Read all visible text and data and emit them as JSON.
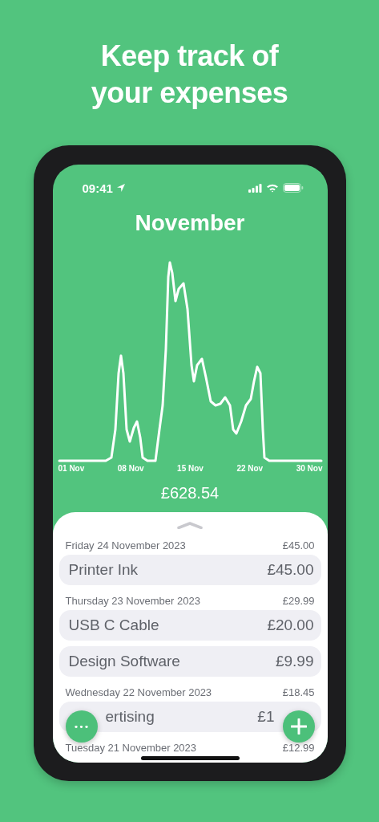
{
  "headline": "Keep track of your expenses",
  "status_bar": {
    "time": "09:41"
  },
  "title": "November",
  "chart_axis_labels": [
    "01 Nov",
    "08 Nov",
    "15 Nov",
    "22 Nov",
    "30 Nov"
  ],
  "total": "£628.54",
  "entries": [
    {
      "kind": "date",
      "date": "Friday 24 November 2023",
      "amount": "£45.00"
    },
    {
      "kind": "item",
      "name": "Printer Ink",
      "amount": "£45.00",
      "covered": false
    },
    {
      "kind": "date",
      "date": "Thursday 23 November 2023",
      "amount": "£29.99"
    },
    {
      "kind": "item",
      "name": "USB C Cable",
      "amount": "£20.00",
      "covered": false
    },
    {
      "kind": "item",
      "name": "Design Software",
      "amount": "£9.99",
      "covered": false
    },
    {
      "kind": "date",
      "date": "Wednesday 22 November 2023",
      "amount": "£18.45"
    },
    {
      "kind": "item",
      "name": "ertising",
      "amount": "£1",
      "covered": true
    },
    {
      "kind": "date",
      "date": "Tuesday 21 November 2023",
      "amount": "£12.99"
    }
  ],
  "actions": [
    {
      "kind": "more",
      "label": "•••"
    },
    {
      "kind": "add"
    }
  ]
}
